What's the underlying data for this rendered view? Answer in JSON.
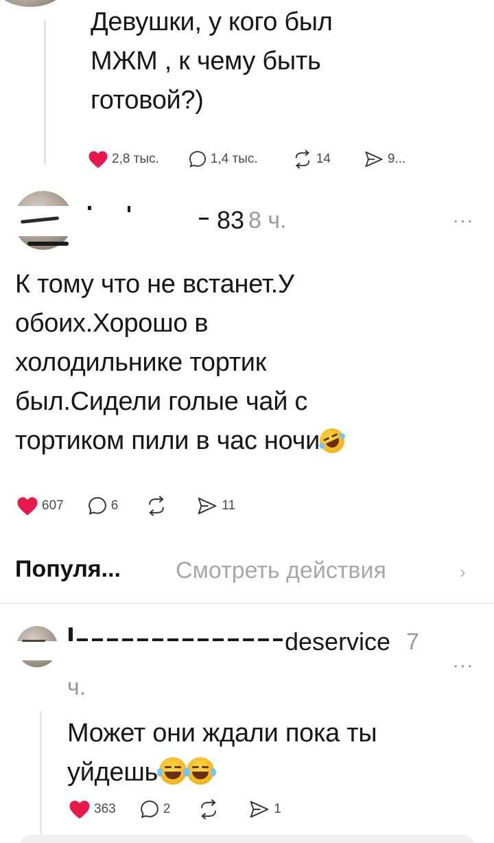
{
  "post1": {
    "text_lines": [
      "Девушки, у кого был",
      "МЖМ , к чему быть",
      "готовой?)"
    ],
    "likes": "2,8 тыс.",
    "comments": "1,4 тыс.",
    "reposts": "14",
    "shares": "9..."
  },
  "post2": {
    "username_visible": "83",
    "time": "8 ч.",
    "more": "...",
    "text_lines": [
      "К тому что не встанет.У",
      "обоих.Хорошо в",
      "холодильнике тортик",
      "был.Сидели голые чай с",
      "тортиком пили в час ночи"
    ],
    "emoji": "rofl",
    "likes": "607",
    "comments": "6",
    "shares": "11"
  },
  "tabs": {
    "popular": "Популя...",
    "view_activity": "Смотреть действия"
  },
  "reply": {
    "username_visible": "deservice",
    "time_part1": "7",
    "time_part2": "ч.",
    "more": "...",
    "text_lines": [
      "Может они ждали пока ты",
      "уйдешь"
    ],
    "emoji": "joy",
    "likes": "363",
    "comments": "2",
    "shares": "1"
  },
  "colors": {
    "like_heart": "#e8184a",
    "muted_text": "#9a9a9a",
    "divider": "#ececec"
  }
}
